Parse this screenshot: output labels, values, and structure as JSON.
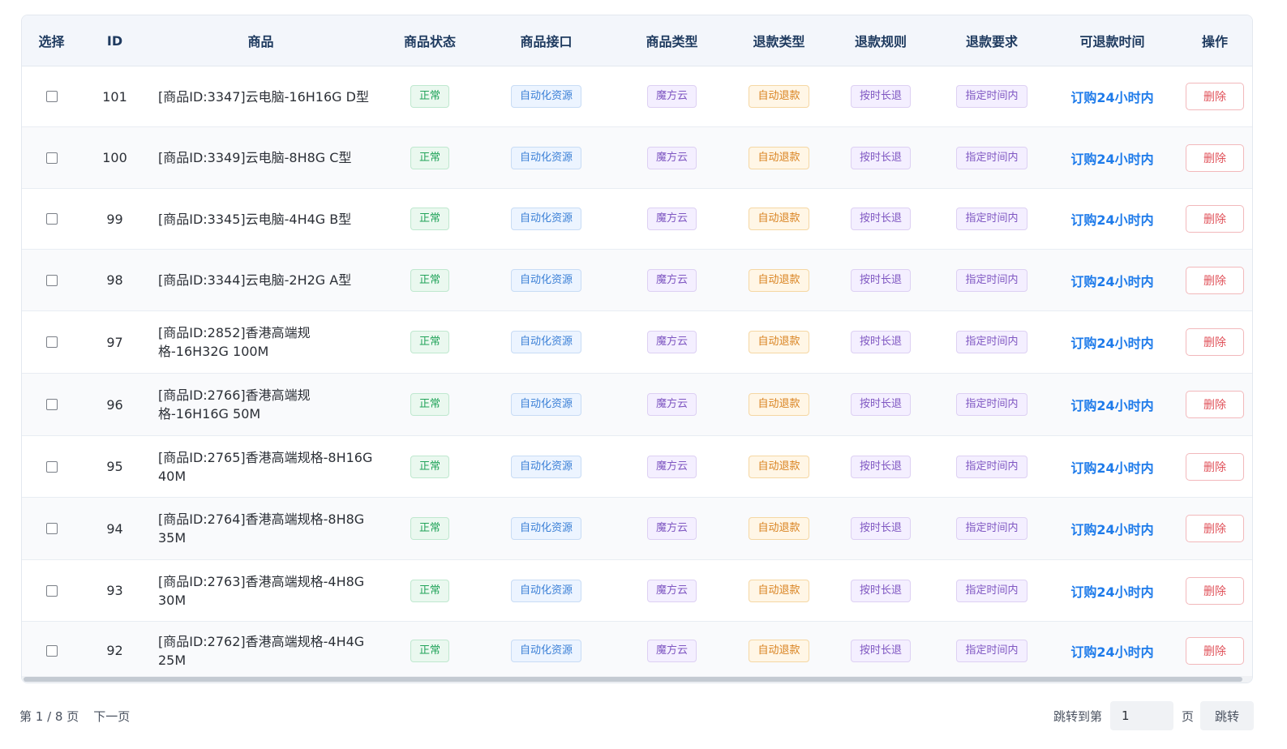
{
  "table": {
    "headers": [
      "选择",
      "ID",
      "商品",
      "商品状态",
      "商品接口",
      "商品类型",
      "退款类型",
      "退款规则",
      "退款要求",
      "可退款时间",
      "操作"
    ],
    "rows": [
      {
        "id": "101",
        "name": "[商品ID:3347]云电脑-16H16G D型",
        "status": "正常",
        "api": "自动化资源",
        "type": "魔方云",
        "refund_type": "自动退款",
        "rule": "按时长退",
        "req": "指定时间内",
        "time": "订购24小时内",
        "action": "删除"
      },
      {
        "id": "100",
        "name": "[商品ID:3349]云电脑-8H8G C型",
        "status": "正常",
        "api": "自动化资源",
        "type": "魔方云",
        "refund_type": "自动退款",
        "rule": "按时长退",
        "req": "指定时间内",
        "time": "订购24小时内",
        "action": "删除"
      },
      {
        "id": "99",
        "name": "[商品ID:3345]云电脑-4H4G B型",
        "status": "正常",
        "api": "自动化资源",
        "type": "魔方云",
        "refund_type": "自动退款",
        "rule": "按时长退",
        "req": "指定时间内",
        "time": "订购24小时内",
        "action": "删除"
      },
      {
        "id": "98",
        "name": "[商品ID:3344]云电脑-2H2G A型",
        "status": "正常",
        "api": "自动化资源",
        "type": "魔方云",
        "refund_type": "自动退款",
        "rule": "按时长退",
        "req": "指定时间内",
        "time": "订购24小时内",
        "action": "删除"
      },
      {
        "id": "97",
        "name": "[商品ID:2852]香港高端规格-16H32G 100M",
        "status": "正常",
        "api": "自动化资源",
        "type": "魔方云",
        "refund_type": "自动退款",
        "rule": "按时长退",
        "req": "指定时间内",
        "time": "订购24小时内",
        "action": "删除"
      },
      {
        "id": "96",
        "name": "[商品ID:2766]香港高端规格-16H16G 50M",
        "status": "正常",
        "api": "自动化资源",
        "type": "魔方云",
        "refund_type": "自动退款",
        "rule": "按时长退",
        "req": "指定时间内",
        "time": "订购24小时内",
        "action": "删除"
      },
      {
        "id": "95",
        "name": "[商品ID:2765]香港高端规格-8H16G 40M",
        "status": "正常",
        "api": "自动化资源",
        "type": "魔方云",
        "refund_type": "自动退款",
        "rule": "按时长退",
        "req": "指定时间内",
        "time": "订购24小时内",
        "action": "删除"
      },
      {
        "id": "94",
        "name": "[商品ID:2764]香港高端规格-8H8G 35M",
        "status": "正常",
        "api": "自动化资源",
        "type": "魔方云",
        "refund_type": "自动退款",
        "rule": "按时长退",
        "req": "指定时间内",
        "time": "订购24小时内",
        "action": "删除"
      },
      {
        "id": "93",
        "name": "[商品ID:2763]香港高端规格-4H8G 30M",
        "status": "正常",
        "api": "自动化资源",
        "type": "魔方云",
        "refund_type": "自动退款",
        "rule": "按时长退",
        "req": "指定时间内",
        "time": "订购24小时内",
        "action": "删除"
      },
      {
        "id": "92",
        "name": "[商品ID:2762]香港高端规格-4H4G 25M",
        "status": "正常",
        "api": "自动化资源",
        "type": "魔方云",
        "refund_type": "自动退款",
        "rule": "按时长退",
        "req": "指定时间内",
        "time": "订购24小时内",
        "action": "删除"
      }
    ]
  },
  "pagination": {
    "page_info": "第 1 / 8 页",
    "next_label": "下一页",
    "jump_label": "跳转到第",
    "jump_value": "1",
    "page_suffix": "页",
    "jump_button": "跳转"
  }
}
